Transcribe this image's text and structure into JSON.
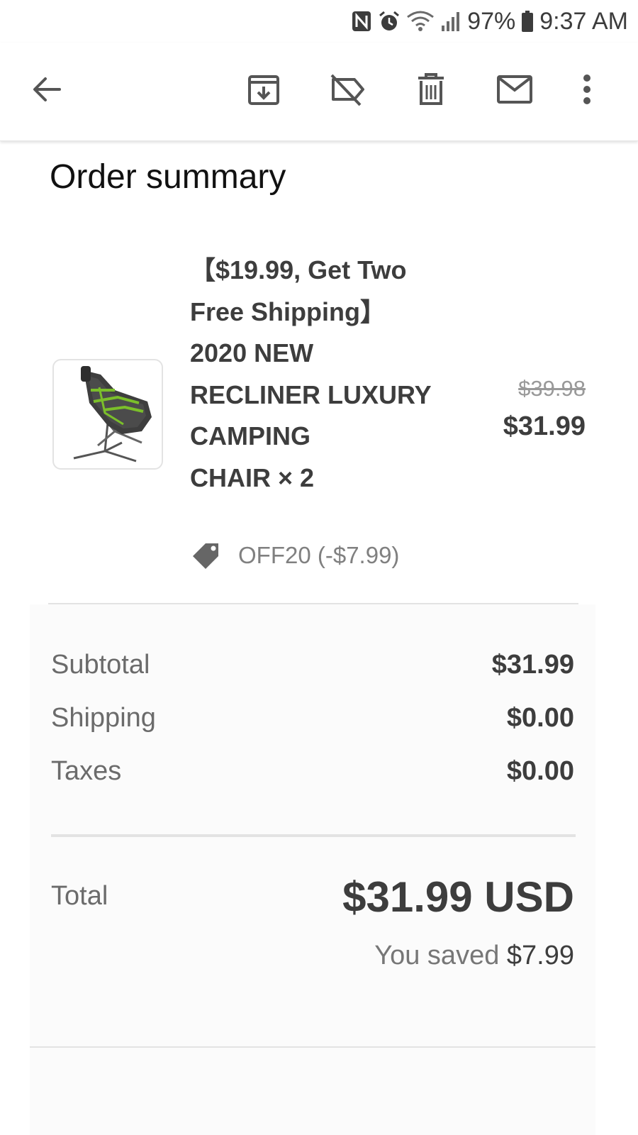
{
  "status_bar": {
    "battery": "97%",
    "time": "9:37 AM",
    "icons": [
      "nfc-icon",
      "alarm-icon",
      "wifi-icon",
      "signal-icon",
      "battery-icon"
    ]
  },
  "toolbar": {
    "icons": [
      "back-arrow-icon",
      "archive-icon",
      "label-off-icon",
      "delete-icon",
      "mail-icon",
      "more-vert-icon"
    ]
  },
  "order": {
    "title": "Order summary",
    "product": {
      "name_lines": [
        "【$19.99, Get Two",
        "Free Shipping】",
        "2020 NEW",
        "RECLINER LUXURY",
        "CAMPING",
        "CHAIR × 2"
      ],
      "original_price": "$39.98",
      "price": "$31.99"
    },
    "discount": "OFF20 (-$7.99)",
    "summary": {
      "subtotal_label": "Subtotal",
      "subtotal_value": "$31.99",
      "shipping_label": "Shipping",
      "shipping_value": "$0.00",
      "taxes_label": "Taxes",
      "taxes_value": "$0.00"
    },
    "total": {
      "label": "Total",
      "value": "$31.99 USD",
      "saved_prefix": "You saved",
      "saved_amount": "$7.99"
    }
  },
  "colors": {
    "text_dark": "#3d3d3d",
    "text_muted": "#6b6b6b",
    "divider": "#e3e3e3",
    "chair_accent": "#7bbf2a"
  }
}
